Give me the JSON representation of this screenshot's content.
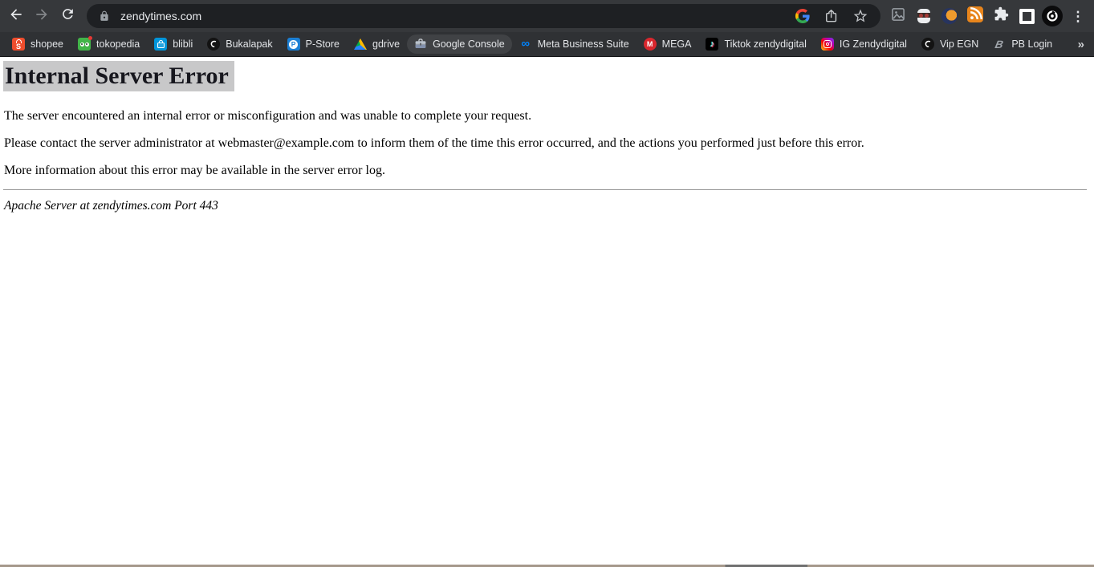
{
  "toolbar": {
    "url": "zendytimes.com",
    "icons": [
      "back-arrow",
      "forward-arrow",
      "reload",
      "lock",
      "google-g",
      "share",
      "star-bookmark",
      "image-extension",
      "ninja-extension",
      "sphere-extension",
      "rss-extension",
      "extensions-puzzle",
      "side-panel",
      "profile-avatar",
      "menu-dots"
    ]
  },
  "glyphs": {
    "shopee": "S",
    "p_store": "P",
    "mega": "M",
    "meta": "∞",
    "tiktok": "♪",
    "pb_login": "B",
    "overflow": "»",
    "menu_dots": "⋮"
  },
  "bookmarks_bar": {
    "items": [
      {
        "label": "shopee",
        "icon": "shopee-icon",
        "color": "#ee4d2d"
      },
      {
        "label": "tokopedia",
        "icon": "tokopedia-icon",
        "color": "#42b549"
      },
      {
        "label": "blibli",
        "icon": "blibli-icon",
        "color": "#0095da"
      },
      {
        "label": "Bukalapak",
        "icon": "bukalapak-icon",
        "color": "#131313"
      },
      {
        "label": "P-Store",
        "icon": "p-store-icon",
        "color": "#1b7fd4"
      },
      {
        "label": "gdrive",
        "icon": "google-drive-icon"
      },
      {
        "label": "Google Console",
        "icon": "toolbox-icon",
        "highlighted": true
      },
      {
        "label": "Meta Business Suite",
        "icon": "meta-icon",
        "color": "#0082fb"
      },
      {
        "label": "MEGA",
        "icon": "mega-icon",
        "color": "#d9272e"
      },
      {
        "label": "Tiktok zendydigital",
        "icon": "tiktok-icon",
        "color": "#000000"
      },
      {
        "label": "IG Zendydigital",
        "icon": "instagram-icon"
      },
      {
        "label": "Vip EGN",
        "icon": "vip-egn-icon",
        "color": "#131313"
      },
      {
        "label": "PB Login",
        "icon": "pb-login-icon",
        "color": "#a0a5ab"
      }
    ]
  },
  "page": {
    "title": "Internal Server Error",
    "paragraphs": [
      "The server encountered an internal error or misconfiguration and was unable to complete your request.",
      "Please contact the server administrator at webmaster@example.com to inform them of the time this error occurred, and the actions you performed just before this error.",
      "More information about this error may be available in the server error log."
    ],
    "footer": "Apache Server at zendytimes.com Port 443"
  },
  "colors": {
    "toolbar_bg": "#36383b",
    "bookmarks_bg": "#2f3134",
    "omnibox_bg": "#1e2023",
    "bookmark_hover_pill": "#404245",
    "toolbar_text": "#e8eaed",
    "title_selection_highlight": "#c8c8c9",
    "page_bg": "#ffffff",
    "bottom_strip": "#a5988b"
  }
}
